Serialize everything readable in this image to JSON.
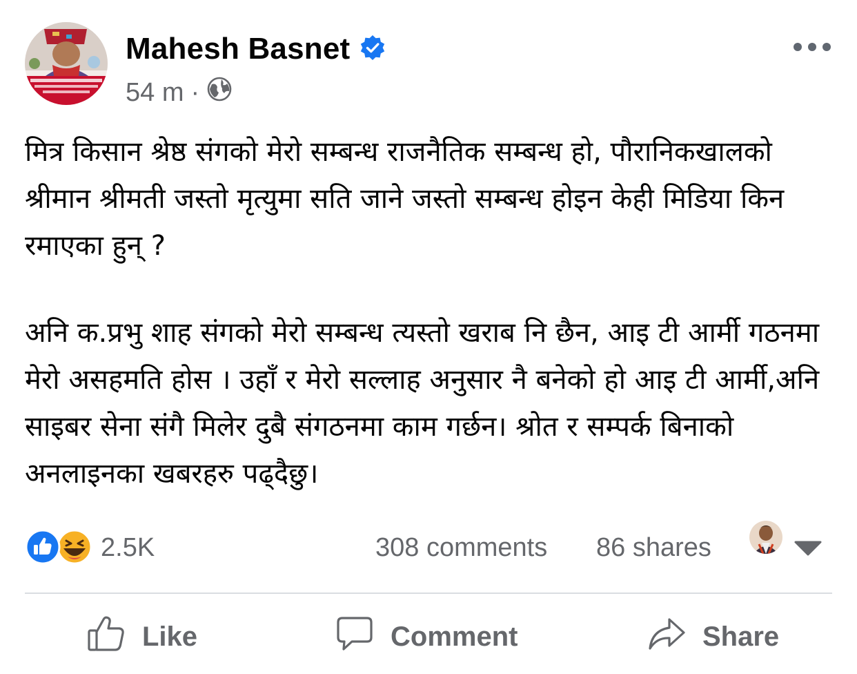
{
  "post": {
    "author": "Mahesh Basnet",
    "verified": true,
    "timestamp": "54 m",
    "separator": "·",
    "privacy_icon": "globe-icon",
    "more_icon": "ellipsis-icon",
    "paragraphs": [
      "मित्र किसान श्रेष्ठ संगको मेरो सम्बन्ध राजनैतिक सम्बन्ध हो, पौरानिकखालको श्रीमान श्रीमती जस्तो मृत्युमा सति जाने जस्तो सम्बन्ध होइन केही मिडिया किन रमाएका हुन् ?",
      "अनि क.प्रभु शाह संगको मेरो सम्बन्ध त्यस्तो खराब नि छैन, आइ टी आर्मी गठनमा मेरो असहमति होस । उहाँ र मेरो सल्लाह अनुसार नै बनेको हो आइ टी आर्मी,अनि साइबर सेना संगै मिलेर दुबै संगठनमा काम गर्छन। श्रोत र सम्पर्क बिनाको अनलाइनका खबरहरु पढ्दैछु।"
    ]
  },
  "stats": {
    "reactions": [
      "like",
      "haha"
    ],
    "reaction_count": "2.5K",
    "comments": "308 comments",
    "shares": "86 shares"
  },
  "actions": {
    "like": "Like",
    "comment": "Comment",
    "share": "Share"
  },
  "colors": {
    "verified_blue": "#1877f2",
    "secondary_text": "#65676b",
    "like_blue": "#1877f2",
    "haha_yellow": "#f7b125"
  }
}
